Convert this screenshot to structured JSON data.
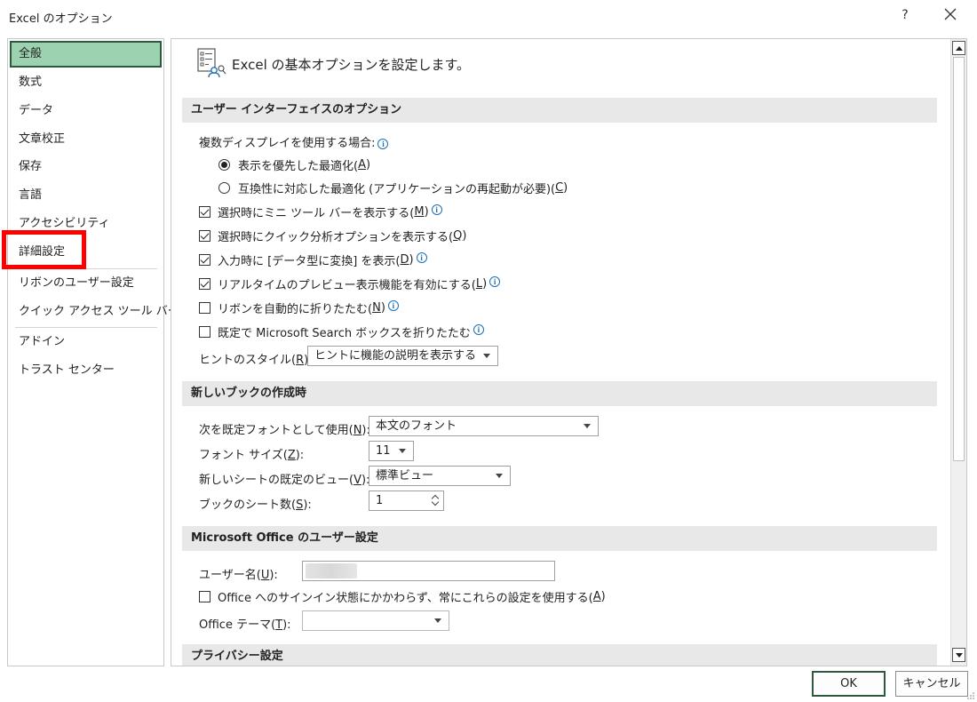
{
  "window": {
    "title": "Excel のオプション",
    "help_label": "?"
  },
  "nav": {
    "items": [
      {
        "label": "全般"
      },
      {
        "label": "数式"
      },
      {
        "label": "データ"
      },
      {
        "label": "文章校正"
      },
      {
        "label": "保存"
      },
      {
        "label": "言語"
      },
      {
        "label": "アクセシビリティ"
      },
      {
        "label": "詳細設定"
      },
      {
        "label": "リボンのユーザー設定"
      },
      {
        "label": "クイック アクセス ツール バー"
      },
      {
        "label": "アドイン"
      },
      {
        "label": "トラスト センター"
      }
    ],
    "selected": "全般",
    "highlighted": "詳細設定",
    "highlight_color": "#ff0000",
    "selected_color": "#9dd2b0"
  },
  "content": {
    "header": "Excel の基本オプションを設定します。",
    "ui_section": {
      "title": "ユーザー インターフェイスのオプション",
      "multi_display_label": "複数ディスプレイを使用する場合:",
      "radio_optimize_display": {
        "text": "表示を優先した最適化(",
        "key": "A",
        "end": ")",
        "checked": true
      },
      "radio_optimize_compat": {
        "text": "互換性に対応した最適化 (アプリケーションの再起動が必要)(",
        "key": "C",
        "end": ")",
        "checked": false
      },
      "checkboxes": [
        {
          "text": "選択時にミニ ツール バーを表示する(",
          "key": "M",
          "end": ")",
          "checked": true,
          "info": true
        },
        {
          "text": "選択時にクイック分析オプションを表示する(",
          "key": "Q",
          "end": ")",
          "checked": true,
          "info": false
        },
        {
          "text": "入力時に [データ型に変換] を表示(",
          "key": "D",
          "end": ")",
          "checked": true,
          "info": true
        },
        {
          "text": "リアルタイムのプレビュー表示機能を有効にする(",
          "key": "L",
          "end": ")",
          "checked": true,
          "info": true
        },
        {
          "text": "リボンを自動的に折りたたむ(",
          "key": "N",
          "end": ")",
          "checked": false,
          "info": true
        },
        {
          "text": "既定で Microsoft Search ボックスを折りたたむ",
          "key": "",
          "end": "",
          "checked": false,
          "info": true
        }
      ],
      "tooltip_style": {
        "text": "ヒントのスタイル(",
        "key": "R",
        "end": "):",
        "value": "ヒントに機能の説明を表示する"
      }
    },
    "workbook_section": {
      "title": "新しいブックの作成時",
      "font": {
        "text": "次を既定フォントとして使用(",
        "key": "N",
        "end": "):",
        "value": "本文のフォント"
      },
      "font_size": {
        "text": "フォント サイズ(",
        "key": "Z",
        "end": "):",
        "value": "11"
      },
      "default_view": {
        "text": "新しいシートの既定のビュー(",
        "key": "V",
        "end": "):",
        "value": "標準ビュー"
      },
      "sheet_count": {
        "text": "ブックのシート数(",
        "key": "S",
        "end": "):",
        "value": "1"
      }
    },
    "office_section": {
      "title": "Microsoft Office のユーザー設定",
      "username": {
        "text": "ユーザー名(",
        "key": "U",
        "end": "):"
      },
      "always_use": {
        "text": "Office へのサインイン状態にかかわらず、常にこれらの設定を使用する(",
        "key": "A",
        "end": ")",
        "checked": false
      },
      "theme": {
        "text": "Office テーマ(",
        "key": "T",
        "end": "):",
        "value": ""
      }
    },
    "privacy_section": {
      "title": "プライバシー設定"
    }
  },
  "footer": {
    "ok_label": "OK",
    "cancel_label": "キャンセル"
  }
}
